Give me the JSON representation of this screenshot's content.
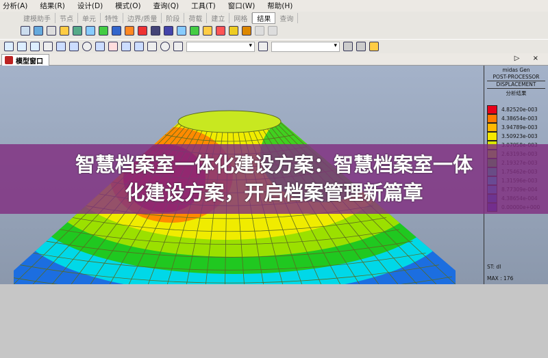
{
  "menu": [
    "分析(A)",
    "结果(R)",
    "设计(D)",
    "模式(O)",
    "查询(Q)",
    "工具(T)",
    "窗口(W)",
    "帮助(H)"
  ],
  "ribbon_tabs": [
    "建模助手",
    "节点",
    "单元",
    "特性",
    "边界/质量",
    "阶段",
    "荷载",
    "建立",
    "网格",
    "结果",
    "查询"
  ],
  "ribbon_active": "结果",
  "model_tab": "模型窗口",
  "window_controls": "▷ ×",
  "legend": {
    "line1": "midas Gen",
    "line2": "POST-PROCESSOR",
    "line3": "DISPLACEMENT",
    "line4": "分析结果",
    "values": [
      "4.82520e-003",
      "4.38654e-003",
      "3.94789e-003",
      "3.50923e-003",
      "3.07058e-003",
      "2.63193e-003",
      "2.19327e-003",
      "1.75462e-003",
      "1.31596e-003",
      "8.77309e-004",
      "4.38654e-004",
      "0.00000e+000"
    ],
    "colors": [
      "#e8001a",
      "#ff7a00",
      "#ffb800",
      "#f5e800",
      "#d8e800",
      "#9be000",
      "#30d020",
      "#00d0a0",
      "#00c8e8",
      "#1c8ce8",
      "#1a50d8",
      "#3a2cc8"
    ],
    "st": "ST: dl",
    "max": "MAX : 176"
  },
  "banner": {
    "line1": "智慧档案室一体化建设方案：智慧档案室一体",
    "line2": "化建设方案，开启档案管理新篇章"
  }
}
